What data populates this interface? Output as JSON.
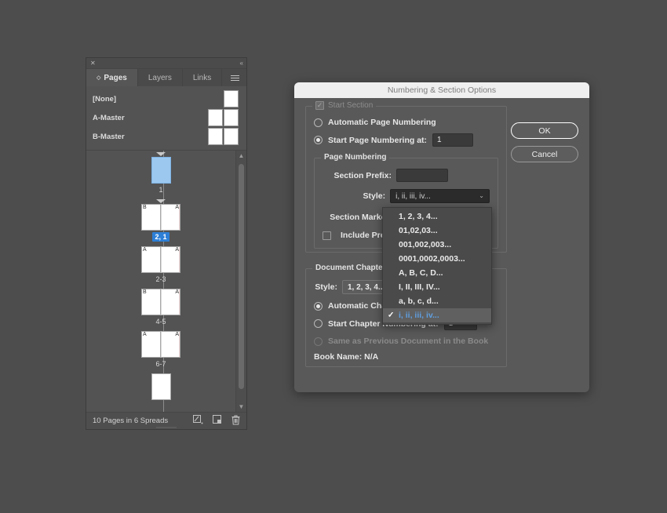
{
  "panel": {
    "close_icon": "close-icon",
    "collapse_icon": "collapse-icon",
    "tabs": [
      {
        "label": "Pages",
        "active": true
      },
      {
        "label": "Layers",
        "active": false
      },
      {
        "label": "Links",
        "active": false
      }
    ],
    "menu_icon": "hamburger-menu-icon",
    "masters": [
      {
        "label": "[None]",
        "thumbs": 1
      },
      {
        "label": "A-Master",
        "thumbs": 2
      },
      {
        "label": "B-Master",
        "thumbs": 2
      }
    ],
    "spreads": [
      {
        "label": "1",
        "selected": true,
        "pages": [
          {
            "marker": "",
            "right": false
          }
        ],
        "has_caret": true,
        "highlight": false
      },
      {
        "label": "2, 1",
        "selected": false,
        "pages": [
          {
            "marker": "B",
            "right": false
          },
          {
            "marker": "A",
            "right": true
          }
        ],
        "has_caret": true,
        "highlight": true
      },
      {
        "label": "2-3",
        "selected": false,
        "pages": [
          {
            "marker": "A",
            "right": false
          },
          {
            "marker": "A",
            "right": true
          }
        ],
        "has_caret": false,
        "highlight": false
      },
      {
        "label": "4-5",
        "selected": false,
        "pages": [
          {
            "marker": "B",
            "right": false
          },
          {
            "marker": "A",
            "right": true
          }
        ],
        "has_caret": false,
        "highlight": false
      },
      {
        "label": "6-7",
        "selected": false,
        "pages": [
          {
            "marker": "A",
            "right": false
          },
          {
            "marker": "A",
            "right": true
          }
        ],
        "has_caret": false,
        "highlight": false
      },
      {
        "label": "",
        "selected": false,
        "pages": [
          {
            "marker": "",
            "right": false
          }
        ],
        "has_caret": false,
        "highlight": false
      }
    ],
    "footer": {
      "status": "10 Pages in 6 Spreads",
      "icons": [
        "edit-page-size-icon",
        "new-page-icon",
        "delete-page-icon"
      ]
    }
  },
  "dialog": {
    "title": "Numbering & Section Options",
    "buttons": {
      "ok": "OK",
      "cancel": "Cancel"
    },
    "start_section": {
      "label": "Start Section",
      "checked": true
    },
    "automatic_page_numbering": {
      "label": "Automatic Page Numbering",
      "selected": false
    },
    "start_page_numbering_at": {
      "label": "Start Page Numbering at:",
      "selected": true,
      "value": "1"
    },
    "page_numbering": {
      "legend": "Page Numbering",
      "section_prefix_label": "Section Prefix:",
      "section_prefix_value": "",
      "style_label": "Style:",
      "style_value": "i, ii, iii, iv...",
      "section_marker_label": "Section Marker:",
      "section_marker_value": "",
      "include_prefix_label": "Include Prefix",
      "include_prefix_checked": false
    },
    "style_dropdown": {
      "options": [
        {
          "label": "1, 2, 3, 4...",
          "selected": false
        },
        {
          "label": "01,02,03...",
          "selected": false
        },
        {
          "label": "001,002,003...",
          "selected": false
        },
        {
          "label": "0001,0002,0003...",
          "selected": false
        },
        {
          "label": "A, B, C, D...",
          "selected": false
        },
        {
          "label": "I, II, III, IV...",
          "selected": false
        },
        {
          "label": "a, b, c, d...",
          "selected": false
        },
        {
          "label": "i, ii, iii, iv...",
          "selected": true
        }
      ],
      "check_glyph": "✓"
    },
    "document_chapter": {
      "legend": "Document Chapter",
      "style_label": "Style:",
      "style_value": "1, 2, 3, 4...",
      "automatic_chapter_label": "Automatic Cha",
      "automatic_chapter_selected": true,
      "start_chapter_label": "Start Chapter Numbering at:",
      "start_chapter_selected": false,
      "start_chapter_value": "1",
      "same_as_previous_label": "Same as Previous Document in the Book",
      "same_as_previous_selected": false,
      "book_name": "Book Name: N/A"
    }
  },
  "colors": {
    "app_background": "#4d4d4d",
    "panel_background": "#535353",
    "dialog_background": "#595959",
    "accent_blue": "#2d7fd6",
    "selected_page": "#9cc8f0",
    "dropdown_selected_text": "#5f9fe0"
  }
}
